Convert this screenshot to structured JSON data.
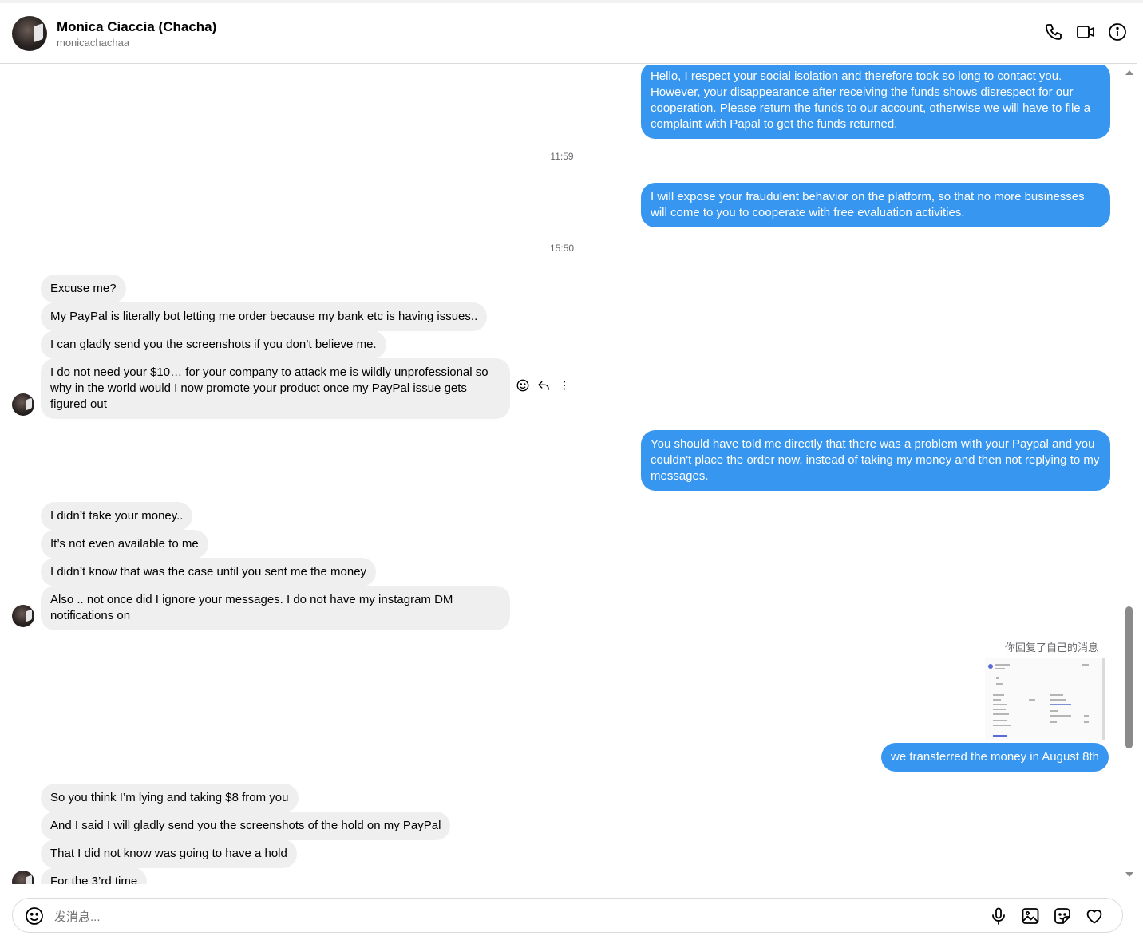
{
  "header": {
    "name": "Monica Ciaccia (Chacha)",
    "username": "monicachachaa",
    "icons": [
      "phone-icon",
      "video-camera-icon",
      "info-icon"
    ]
  },
  "messages": [
    {
      "side": "out",
      "text": "Hello, I respect your social isolation and therefore took so long to contact you. However, your disappearance after receiving the funds shows disrespect for our cooperation. Please return the funds to our account, otherwise we will have to file a complaint with Papal to get the funds returned."
    },
    {
      "type": "timestamp",
      "text": "11:59"
    },
    {
      "side": "out",
      "text": "I will expose your fraudulent behavior on the platform, so that no more businesses will come to you to cooperate with free evaluation activities."
    },
    {
      "type": "timestamp",
      "text": "15:50"
    },
    {
      "side": "in",
      "text": "Excuse me?"
    },
    {
      "side": "in",
      "text": "My PayPal is literally bot letting me order because my bank etc is having issues.."
    },
    {
      "side": "in",
      "text": "I can gladly send you the screenshots if you don’t believe me."
    },
    {
      "side": "in",
      "text": "I do not need your $10… for your company to attack me is wildly unprofessional so why in the world would I now promote your product once my PayPal issue gets figured out"
    },
    {
      "side": "out",
      "text": "You should have told me directly that there was a problem with your Paypal and you couldn't place the order now, instead of taking my money and then not replying to my messages."
    },
    {
      "side": "in",
      "text": "I didn’t take your money.."
    },
    {
      "side": "in",
      "text": "It’s not even available to me"
    },
    {
      "side": "in",
      "text": "I didn’t know that was the case until you sent me the money"
    },
    {
      "side": "in",
      "text": "Also .. not once did I ignore your messages. I do not have my instagram DM notifications on"
    },
    {
      "type": "reply-note",
      "text": "你回复了自己的消息"
    },
    {
      "side": "out",
      "text": "we transferred the money in August 8th"
    },
    {
      "side": "in",
      "text": "So you think I’m lying and taking $8 from you"
    },
    {
      "side": "in",
      "text": "And I said I will gladly send you the screenshots of the hold on my PayPal"
    },
    {
      "side": "in",
      "text": "That I did not know was going to have a hold"
    },
    {
      "side": "in",
      "text": "For the 3’rd time"
    }
  ],
  "composer": {
    "placeholder": "发消息...",
    "icons": [
      "emoji-icon",
      "microphone-icon",
      "image-icon",
      "sticker-icon",
      "heart-icon"
    ]
  },
  "colors": {
    "outgoing_bubble": "#3797f0",
    "incoming_bubble": "#efefef"
  }
}
